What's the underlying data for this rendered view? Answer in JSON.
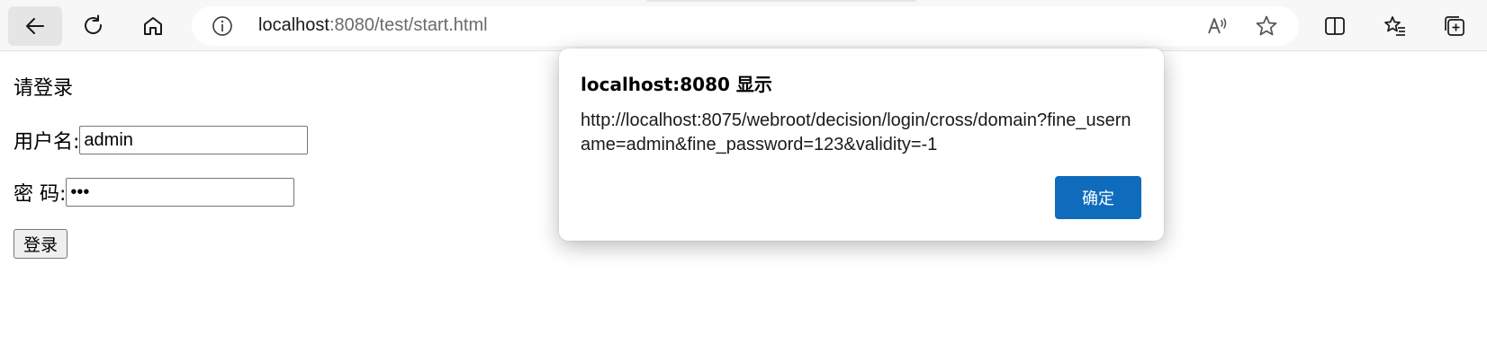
{
  "browser": {
    "url_host": "localhost",
    "url_path": ":8080/test/start.html",
    "icons": {
      "back": "back-arrow-icon",
      "refresh": "refresh-icon",
      "home": "home-icon",
      "info": "info-icon",
      "read_aloud": "read-aloud-icon",
      "favorite": "star-icon",
      "split_screen": "split-screen-icon",
      "favorites": "favorites-list-icon",
      "collections": "collections-icon"
    }
  },
  "page": {
    "heading": "请登录",
    "username_label": "用户名:",
    "username_value": "admin",
    "password_label": "密 码:",
    "password_value": "•••",
    "login_button": "登录"
  },
  "dialog": {
    "title": "localhost:8080 显示",
    "message": "http://localhost:8075/webroot/decision/login/cross/domain?fine_username=admin&fine_password=123&validity=-1",
    "ok_label": "确定",
    "accent_color": "#0f6cbd"
  }
}
